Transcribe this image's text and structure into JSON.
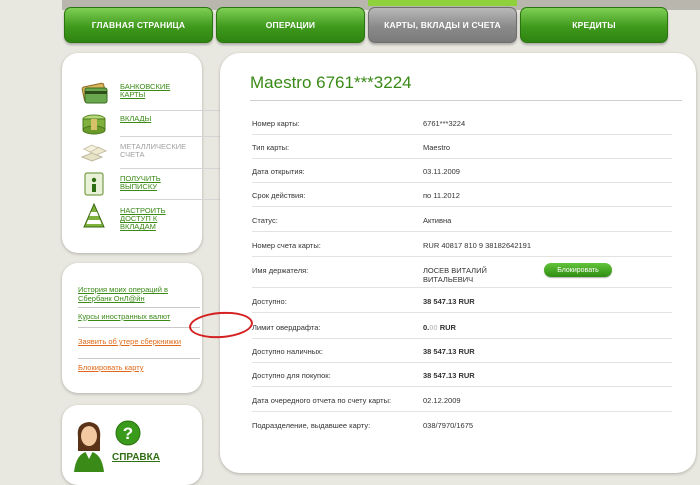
{
  "nav": {
    "tabs": [
      {
        "label": "ГЛАВНАЯ СТРАНИЦА",
        "active": false
      },
      {
        "label": "ОПЕРАЦИИ",
        "active": false
      },
      {
        "label": "КАРТЫ, ВКЛАДЫ И СЧЕТА",
        "active": true
      },
      {
        "label": "КРЕДИТЫ",
        "active": false
      }
    ]
  },
  "sidebar": {
    "menu": [
      {
        "label": "БАНКОВСКИЕ КАРТЫ",
        "icon": "bank-card-icon",
        "enabled": true
      },
      {
        "label": "ВКЛАДЫ",
        "icon": "money-stack-icon",
        "enabled": true
      },
      {
        "label": "МЕТАЛЛИЧЕСКИЕ СЧЕТА",
        "icon": "metal-bars-icon",
        "enabled": false
      },
      {
        "label": "ПОЛУЧИТЬ ВЫПИСКУ",
        "icon": "statement-info-icon",
        "enabled": true
      },
      {
        "label": "НАСТРОИТЬ ДОСТУП К ВКЛАДАМ",
        "icon": "access-cone-icon",
        "enabled": true
      }
    ],
    "links": {
      "history": "История моих операций в Сбербанк ОнЛ@йн",
      "rates": "Курсы иностранных валют",
      "lost_book": "Заявить об утере сберкнижки",
      "block_card": "Блокировать карту"
    },
    "help": {
      "label": "СПРАВКА",
      "icon": "help-question-icon"
    }
  },
  "card": {
    "title": "Maestro 6761***3224",
    "block_button": "Блокировать",
    "rows": [
      {
        "label": "Номер карты:",
        "value": "6761***3224"
      },
      {
        "label": "Тип карты:",
        "value": "Maestro"
      },
      {
        "label": "Дата открытия:",
        "value": "03.11.2009"
      },
      {
        "label": "Срок действия:",
        "value": "по 11.2012"
      },
      {
        "label": "Статус:",
        "value": "Активна"
      },
      {
        "label": "Номер счета карты:",
        "value": "RUR 40817 810 9 38182642191"
      },
      {
        "label": "Имя держателя:",
        "value": "ЛОСЕВ ВИТАЛИЙ ВИТАЛЬЕВИЧ"
      },
      {
        "label": "Доступно:",
        "value": "38 547.13 RUR"
      },
      {
        "label": "Лимит овердрафта:",
        "value_int": "0.",
        "value_frac": "00",
        "value_cur": " RUR"
      },
      {
        "label": "Доступно наличных:",
        "value": "38 547.13 RUR"
      },
      {
        "label": "Доступно для покупок:",
        "value": "38 547.13 RUR"
      },
      {
        "label": "Дата очередного отчета по счету карты:",
        "value": "02.12.2009"
      },
      {
        "label": "Подразделение, выдавшее карту:",
        "value": "038/7970/1675"
      }
    ]
  },
  "colors": {
    "brand_green": "#3a8a17",
    "accent_orange": "#e06a1a",
    "annotation_red": "#d42020"
  }
}
